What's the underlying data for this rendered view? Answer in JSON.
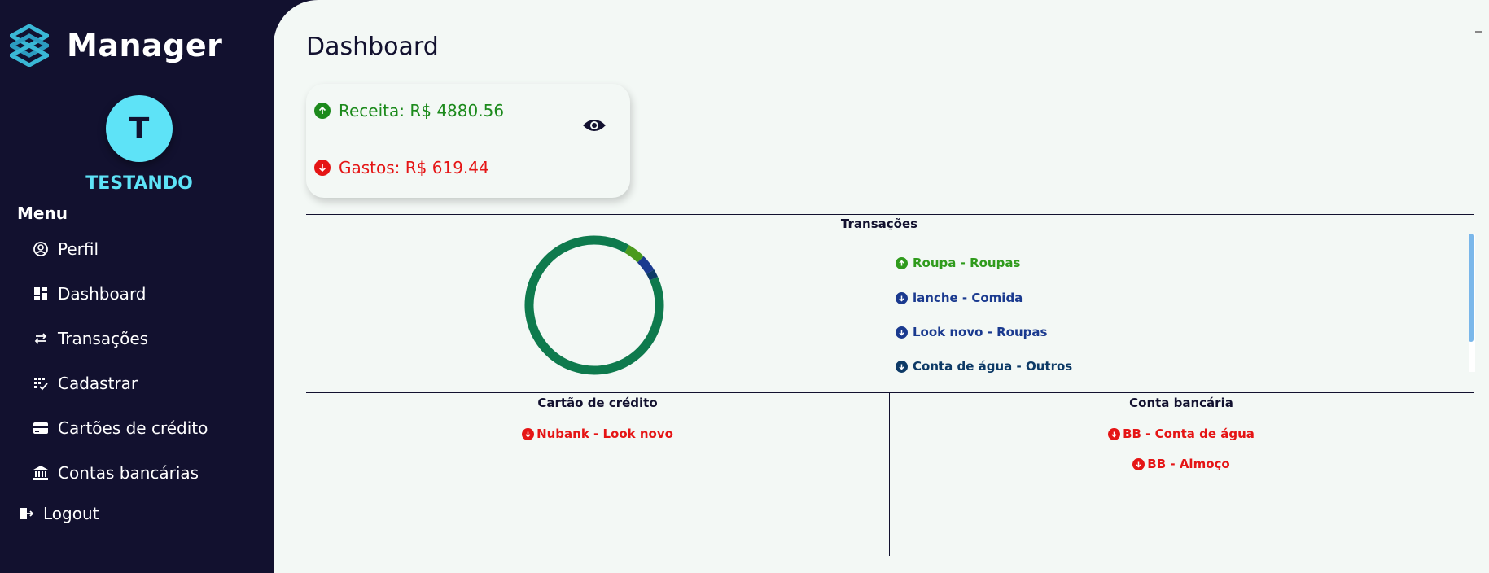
{
  "app": {
    "brand": "Manager"
  },
  "user": {
    "initial": "T",
    "name": "TESTANDO"
  },
  "menu": {
    "heading": "Menu",
    "items": [
      {
        "label": "Perfil",
        "icon": "user-circle-icon"
      },
      {
        "label": "Dashboard",
        "icon": "dashboard-icon"
      },
      {
        "label": "Transações",
        "icon": "swap-arrows-icon"
      },
      {
        "label": "Cadastrar",
        "icon": "grid-check-icon"
      },
      {
        "label": "Cartões de crédito",
        "icon": "credit-card-icon"
      },
      {
        "label": "Contas bancárias",
        "icon": "bank-icon"
      }
    ],
    "logout": "Logout"
  },
  "dashboard": {
    "title": "Dashboard",
    "receita": "Receita: R$ 4880.56",
    "gastos": "Gastos: R$ 619.44"
  },
  "transacoes": {
    "title": "Transações",
    "items": [
      {
        "label": "Roupa - Roupas",
        "type": "income",
        "color": "#2f9b1c"
      },
      {
        "label": "lanche - Comida",
        "type": "expense",
        "color": "#1a3a8f"
      },
      {
        "label": "Look novo - Roupas",
        "type": "expense",
        "color": "#1a3a8f"
      },
      {
        "label": "Conta de água - Outros",
        "type": "expense",
        "color": "#0d3a66"
      }
    ],
    "donut": [
      {
        "name": "Roupa - Roupas",
        "value": 4880.56,
        "color": "#0e7a4d"
      },
      {
        "name": "Roupa",
        "value": 230,
        "color": "#4a9a1e"
      },
      {
        "name": "lanche",
        "value": 210,
        "color": "#1a3a8f"
      },
      {
        "name": "Conta de água",
        "value": 100,
        "color": "#0d3a66"
      }
    ]
  },
  "cartao": {
    "title": "Cartão de crédito",
    "items": [
      "Nubank - Look novo"
    ]
  },
  "conta": {
    "title": "Conta bancária",
    "items": [
      "BB - Conta de água",
      "BB - Almoço"
    ]
  },
  "colors": {
    "sidebar": "#12112f",
    "accent": "#5ee3f7",
    "income": "#1c8a1c",
    "expense": "#e51515",
    "background": "#f3f8f5"
  }
}
